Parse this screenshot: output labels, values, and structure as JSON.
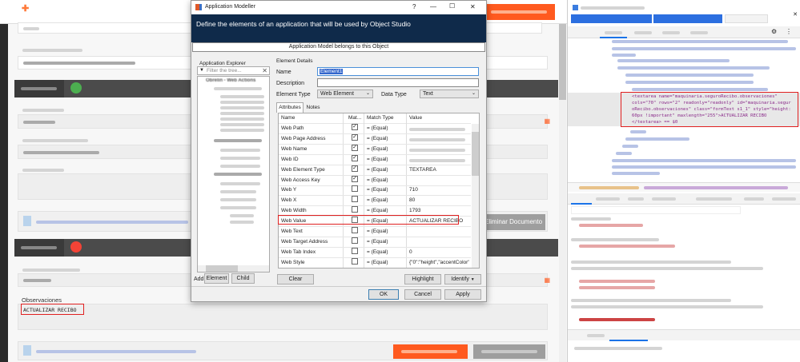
{
  "webpage": {
    "observaciones_label": "Observaciones",
    "observaciones_value": "ACTUALIZAR RECIBO",
    "eliminar_documento": "Eliminar Documento",
    "colors": {
      "accent": "#ff5a1f",
      "dark_bar": "#4b4b4b",
      "ok": "#4caf50",
      "error": "#f44336"
    }
  },
  "dialog": {
    "title": "Application Modeller",
    "help": "?",
    "minimize": "—",
    "maximize": "☐",
    "close": "✕",
    "banner": "Define the elements of an application that will be used by Object Studio",
    "model_belongs": "Application Model belongs to this Object",
    "explorer_label": "Application Explorer",
    "filter_placeholder": "Filter the tree...",
    "tree_root": "Obrelin - Web Actions",
    "details_label": "Element Details",
    "name_label": "Name",
    "name_value": "Element1",
    "description_label": "Description",
    "description_value": "",
    "element_type_label": "Element Type",
    "element_type_value": "Web Element",
    "data_type_label": "Data Type",
    "data_type_value": "Text",
    "tabs": [
      "Attributes",
      "Notes"
    ],
    "columns": {
      "name": "Name",
      "match": "Mat...",
      "match_type": "Match Type",
      "value": "Value"
    },
    "attributes": [
      {
        "name": "Web Path",
        "checked": true,
        "match_type": "= (Equal)",
        "value": ""
      },
      {
        "name": "Web Page Address",
        "checked": true,
        "match_type": "= (Equal)",
        "value": ""
      },
      {
        "name": "Web Name",
        "checked": true,
        "match_type": "= (Equal)",
        "value": ""
      },
      {
        "name": "Web ID",
        "checked": true,
        "match_type": "= (Equal)",
        "value": ""
      },
      {
        "name": "Web Element Type",
        "checked": true,
        "match_type": "= (Equal)",
        "value": "TEXTAREA"
      },
      {
        "name": "Web Access Key",
        "checked": true,
        "match_type": "= (Equal)",
        "value": ""
      },
      {
        "name": "Web Y",
        "checked": false,
        "match_type": "= (Equal)",
        "value": "710"
      },
      {
        "name": "Web X",
        "checked": false,
        "match_type": "= (Equal)",
        "value": "80"
      },
      {
        "name": "Web Width",
        "checked": false,
        "match_type": "= (Equal)",
        "value": "1793"
      },
      {
        "name": "Web Value",
        "checked": false,
        "match_type": "= (Equal)",
        "value": "ACTUALIZAR RECIBO"
      },
      {
        "name": "Web Text",
        "checked": false,
        "match_type": "= (Equal)",
        "value": ""
      },
      {
        "name": "Web Target Address",
        "checked": false,
        "match_type": "= (Equal)",
        "value": ""
      },
      {
        "name": "Web Tab Index",
        "checked": false,
        "match_type": "= (Equal)",
        "value": "0"
      },
      {
        "name": "Web Style",
        "checked": false,
        "match_type": "= (Equal)",
        "value": "{\"0\":\"height\",\"accentColor\":..."
      }
    ],
    "add_label": "Add",
    "element_btn": "Element",
    "child_btn": "Child",
    "clear_btn": "Clear",
    "highlight_btn": "Highlight",
    "identify_btn": "Identify",
    "ok_btn": "OK",
    "cancel_btn": "Cancel",
    "apply_btn": "Apply"
  },
  "devtools": {
    "code_lines": [
      "<textarea name=\"maquinaria.seguroRecibo.observaciones\"",
      "cols=\"70\" rows=\"2\" readonly=\"readonly\" id=\"maquinaria.segur",
      "oRecibo.observaciones\" class=\"formText s1_1\" style=\"height:",
      "60px !important\" maxlength=\"255\">ACTUALIZAR RECIBO",
      "</textarea> == $0"
    ]
  }
}
